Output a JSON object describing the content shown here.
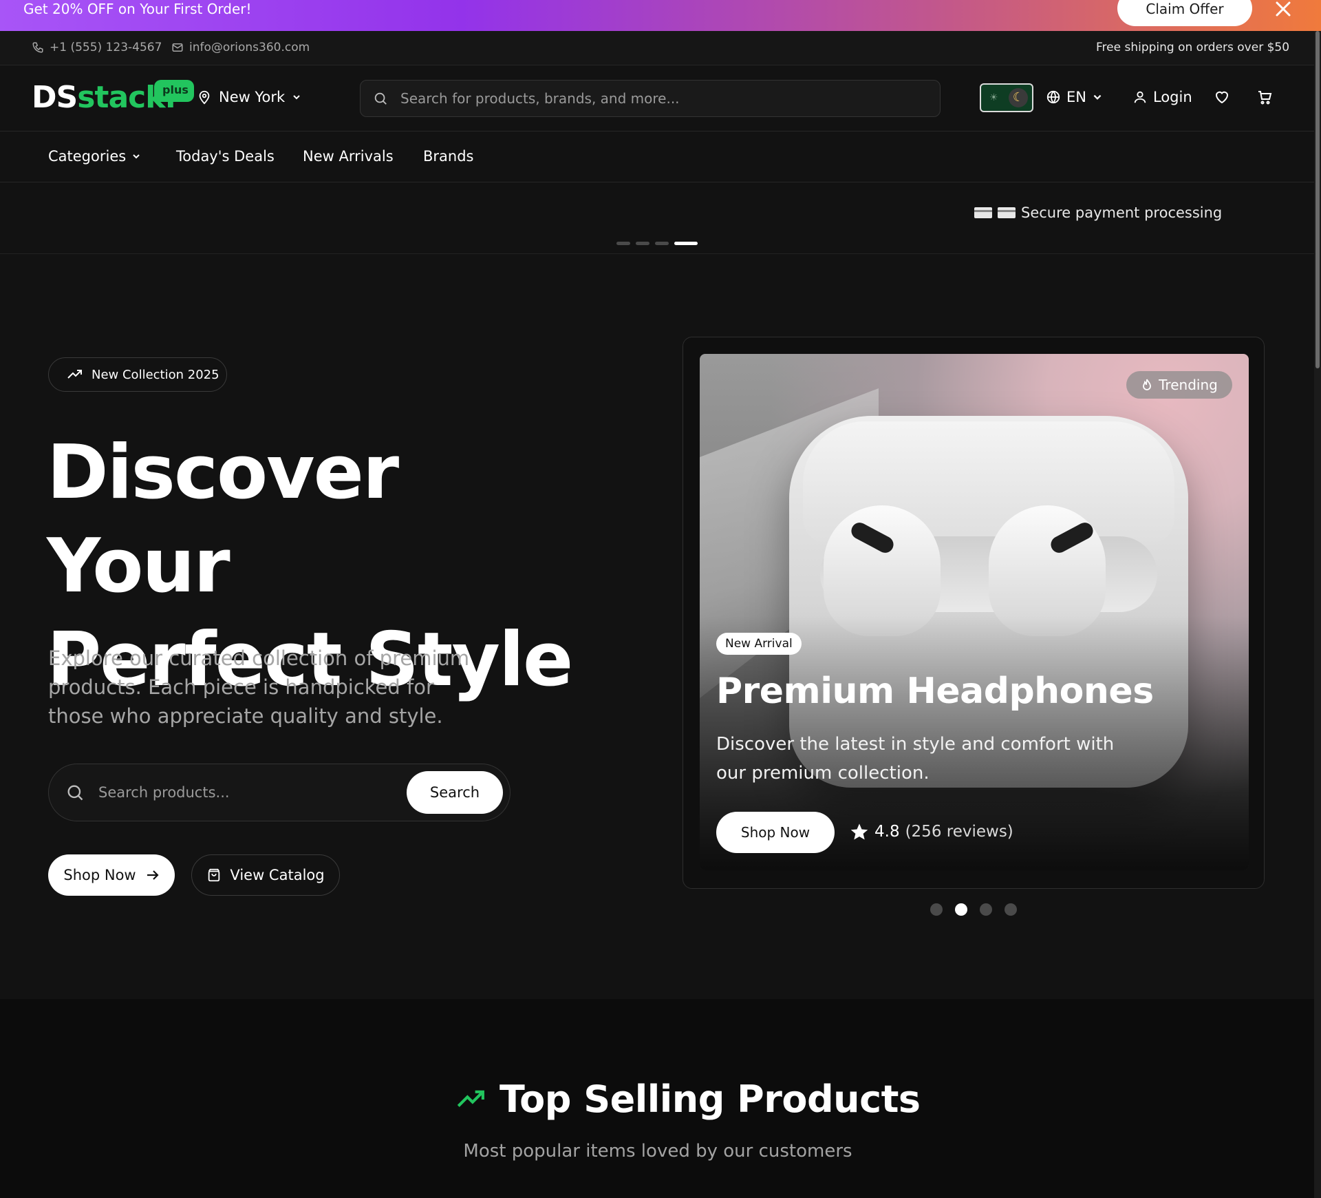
{
  "promo": {
    "text": "Get 20% OFF on Your First Order!",
    "claim_label": "Claim Offer"
  },
  "contact": {
    "phone": "+1 (555) 123-4567",
    "email": "info@orions360.com",
    "shipping": "Free shipping on orders over $50"
  },
  "header": {
    "logo_ds": "DS",
    "logo_stack": "stack.",
    "logo_plus": "plus",
    "location": "New York",
    "search_placeholder": "Search for products, brands, and more...",
    "language": "EN",
    "login": "Login",
    "icons": [
      "phone-icon",
      "mail-icon",
      "map-pin-icon",
      "search-icon",
      "sun-icon",
      "moon-icon",
      "globe-icon",
      "user-icon",
      "heart-icon",
      "cart-icon"
    ]
  },
  "nav": {
    "items": [
      {
        "label": "Categories"
      },
      {
        "label": "Today's Deals"
      },
      {
        "label": "New Arrivals"
      },
      {
        "label": "Brands"
      }
    ]
  },
  "ticker": {
    "text": "Secure payment processing",
    "active_index": 3,
    "count": 4
  },
  "hero": {
    "pill": "New Collection 2025",
    "title_line1": "Discover Your",
    "title_line2": "Perfect Style",
    "description": "Explore our curated collection of premium products. Each piece is handpicked for those who appreciate quality and style.",
    "search_placeholder": "Search products...",
    "search_button": "Search",
    "shop_now": "Shop Now",
    "view_catalog": "View Catalog"
  },
  "slide": {
    "trending": "Trending",
    "badge": "New Arrival",
    "title": "Premium Headphones",
    "description": "Discover the latest in style and comfort with our premium collection.",
    "button": "Shop Now",
    "rating": "4.8",
    "reviews": "(256 reviews)",
    "active_dot": 1,
    "dot_count": 4
  },
  "top_selling": {
    "title": "Top Selling Products",
    "subtitle": "Most popular items loved by our customers",
    "accent": "#22c55e"
  },
  "colors": {
    "background": "#121212",
    "brand_green": "#22c55e",
    "promo_gradient_start": "#a855f7",
    "promo_gradient_end": "#f07a3c"
  }
}
